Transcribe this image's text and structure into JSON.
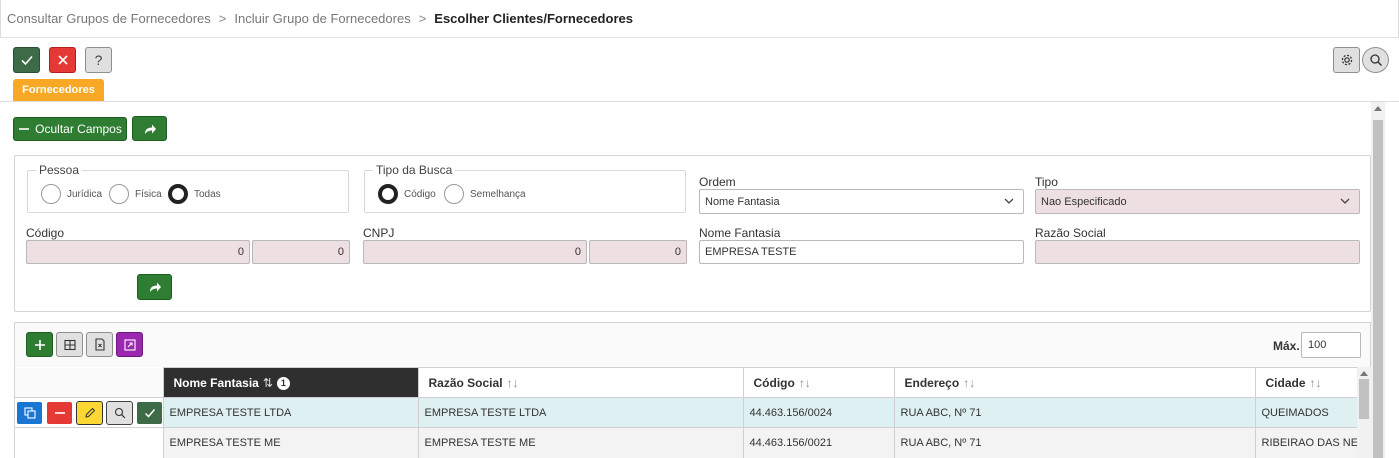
{
  "breadcrumb": {
    "items": [
      "Consultar Grupos de Fornecedores",
      "Incluir Grupo de Fornecedores"
    ],
    "separator": ">",
    "current": "Escolher Clientes/Fornecedores"
  },
  "toolbar": {
    "confirm_icon": "check-icon",
    "cancel_icon": "close-icon",
    "help_label": "?",
    "settings_icon": "gear-icon",
    "search_icon": "search-icon"
  },
  "tab": {
    "label": "Fornecedores",
    "color": "#f9a825"
  },
  "filters": {
    "hide_button": "Ocultar Campos",
    "pessoa": {
      "legend": "Pessoa",
      "options": [
        "Jurídica",
        "Física",
        "Todas"
      ],
      "selected": "Todas"
    },
    "tipo_busca": {
      "legend": "Tipo da Busca",
      "options": [
        "Código",
        "Semelhança"
      ],
      "selected": "Código"
    },
    "ordem": {
      "label": "Ordem",
      "value": "Nome Fantasia"
    },
    "tipo": {
      "label": "Tipo",
      "value": "Nao Especificado"
    },
    "codigo": {
      "label": "Código",
      "from": "0",
      "to": "0"
    },
    "cnpj": {
      "label": "CNPJ",
      "from": "0",
      "to": "0"
    },
    "nome_fantasia": {
      "label": "Nome Fantasia",
      "value": "EMPRESA TESTE"
    },
    "razao_social": {
      "label": "Razão Social",
      "value": ""
    }
  },
  "grid": {
    "max_label": "Máx.",
    "max_value": "100",
    "columns": [
      {
        "label": "Nome Fantasia",
        "sort": "⇅",
        "badge": "1",
        "active": true
      },
      {
        "label": "Razão Social",
        "sort": "↑↓"
      },
      {
        "label": "Código",
        "sort": "↑↓"
      },
      {
        "label": "Endereço",
        "sort": "↑↓"
      },
      {
        "label": "Cidade",
        "sort": "↑↓"
      }
    ],
    "rows": [
      {
        "nome_fantasia": "EMPRESA TESTE LTDA",
        "razao_social": "EMPRESA TESTE LTDA",
        "codigo": "44.463.156/0024",
        "endereco": "RUA ABC, Nº 71",
        "cidade": "QUEIMADOS"
      },
      {
        "nome_fantasia": "EMPRESA TESTE ME",
        "razao_social": "EMPRESA TESTE ME",
        "codigo": "44.463.156/0021",
        "endereco": "RUA ABC, Nº 71",
        "cidade": "RIBEIRAO DAS NEVES"
      }
    ]
  }
}
